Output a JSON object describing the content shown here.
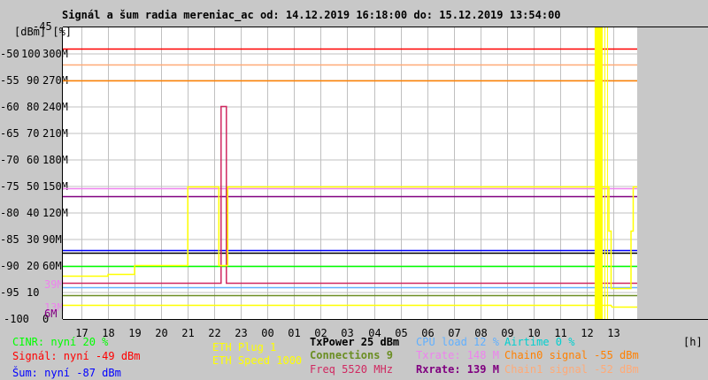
{
  "title": "Signál a šum radia mereniac_ac od: 14.12.2019 16:18:00 do: 15.12.2019 13:54:00",
  "chart_data": {
    "type": "line",
    "title": "Signál a šum radia mereniac_ac od: 14.12.2019 16:18:00 do: 15.12.2019 13:54:00",
    "x_start": "2019-12-14 16:18",
    "x_end": "2019-12-15 13:54",
    "xlabel": "[h]",
    "x_ticks": [
      "17",
      "18",
      "19",
      "20",
      "21",
      "22",
      "23",
      "00",
      "01",
      "02",
      "03",
      "04",
      "05",
      "06",
      "07",
      "08",
      "09",
      "10",
      "11",
      "12",
      "13"
    ],
    "y_axes": {
      "dBm": {
        "unit": "[dBm]",
        "range": [
          -100,
          -45
        ],
        "ticks": [
          "-45",
          "-50",
          "-55",
          "-60",
          "-65",
          "-70",
          "-75",
          "-80",
          "-85",
          "-90",
          "-95",
          "-100"
        ]
      },
      "percent": {
        "unit": "[%]",
        "range": [
          0,
          110
        ],
        "ticks": [
          "100",
          "90",
          "80",
          "70",
          "60",
          "50",
          "40",
          "30",
          "20",
          "10",
          "0"
        ]
      },
      "M": {
        "range": [
          0,
          330
        ],
        "ticks": [
          "300M",
          "270M",
          "240M",
          "210M",
          "180M",
          "150M",
          "120M",
          "90M",
          "60M"
        ]
      }
    },
    "extra_axis_labels": [
      {
        "text": "39M",
        "color": "#ee82ee",
        "value": 39
      },
      {
        "text": "13M",
        "color": "#ee82ee",
        "value": 13
      },
      {
        "text": "6M",
        "color": "#800080",
        "value": 6
      }
    ],
    "grid": true,
    "outage_band": [
      "2019-12-15 12:18",
      "2019-12-15 12:36"
    ],
    "series": [
      {
        "name": "Signál",
        "axis": "dBm",
        "color": "#ff0000",
        "points": [
          [
            "2019-12-14 16:18",
            -49
          ],
          [
            "2019-12-15 13:54",
            -49
          ]
        ]
      },
      {
        "name": "Chain1 signal",
        "axis": "dBm",
        "color": "#ffaa77",
        "points": [
          [
            "2019-12-14 16:18",
            -52
          ],
          [
            "2019-12-15 13:54",
            -52
          ]
        ]
      },
      {
        "name": "Chain0 signal",
        "axis": "dBm",
        "color": "#ff8000",
        "points": [
          [
            "2019-12-14 16:18",
            -55
          ],
          [
            "2019-12-15 13:54",
            -55
          ]
        ]
      },
      {
        "name": "Txrate",
        "axis": "M",
        "color": "#ee82ee",
        "points": [
          [
            "2019-12-14 16:18",
            148
          ],
          [
            "2019-12-15 13:54",
            148
          ]
        ]
      },
      {
        "name": "Rxrate",
        "axis": "M",
        "color": "#800080",
        "points": [
          [
            "2019-12-14 16:18",
            139
          ],
          [
            "2019-12-15 13:54",
            139
          ]
        ]
      },
      {
        "name": "Šum",
        "axis": "dBm",
        "color": "#0000ff",
        "points": [
          [
            "2019-12-14 16:18",
            -87
          ],
          [
            "2019-12-15 13:54",
            -87
          ]
        ]
      },
      {
        "name": "TxPower",
        "axis": "dBm",
        "color": "#000000",
        "points": [
          [
            "2019-12-14 16:18",
            -87.5
          ],
          [
            "2019-12-15 13:54",
            -87.5
          ]
        ]
      },
      {
        "name": "CINR",
        "axis": "percent",
        "color": "#00ff00",
        "points": [
          [
            "2019-12-14 16:18",
            20
          ],
          [
            "2019-12-15 13:54",
            20
          ]
        ]
      },
      {
        "name": "Freq",
        "axis": "M",
        "color": "#d02860",
        "points": [
          [
            "2019-12-14 16:18",
            41
          ],
          [
            "2019-12-14 22:15",
            41
          ],
          [
            "2019-12-14 22:15",
            241
          ],
          [
            "2019-12-14 22:27",
            241
          ],
          [
            "2019-12-14 22:27",
            41
          ],
          [
            "2019-12-15 13:54",
            41
          ]
        ]
      },
      {
        "name": "CPU load",
        "axis": "percent",
        "color": "#60b0ff",
        "points": [
          [
            "2019-12-14 16:18",
            12
          ],
          [
            "2019-12-15 13:54",
            12
          ]
        ]
      },
      {
        "name": "Connections",
        "axis": "percent",
        "color": "#6b8e23",
        "points": [
          [
            "2019-12-14 16:18",
            9
          ],
          [
            "2019-12-15 13:54",
            9
          ]
        ]
      },
      {
        "name": "ETH Plug",
        "axis": "M",
        "color": "#ffff00",
        "points": [
          [
            "2019-12-14 16:18",
            16
          ],
          [
            "2019-12-15 12:55",
            16
          ],
          [
            "2019-12-15 12:57",
            14
          ],
          [
            "2019-12-15 13:54",
            14
          ]
        ]
      },
      {
        "name": "ETH Speed",
        "axis": "M",
        "color": "#ffff00",
        "points": [
          [
            "2019-12-14 16:18",
            49
          ],
          [
            "2019-12-14 18:00",
            49
          ],
          [
            "2019-12-14 18:00",
            51
          ],
          [
            "2019-12-14 19:00",
            51
          ],
          [
            "2019-12-14 19:00",
            61
          ],
          [
            "2019-12-14 21:00",
            61
          ],
          [
            "2019-12-14 21:00",
            105
          ],
          [
            "2019-12-14 21:00",
            150
          ],
          [
            "2019-12-14 22:10",
            150
          ],
          [
            "2019-12-14 22:10",
            61
          ],
          [
            "2019-12-14 22:30",
            61
          ],
          [
            "2019-12-14 22:30",
            150
          ],
          [
            "2019-12-15 12:50",
            150
          ],
          [
            "2019-12-15 12:50",
            100
          ],
          [
            "2019-12-15 12:55",
            100
          ],
          [
            "2019-12-15 12:55",
            35
          ],
          [
            "2019-12-15 13:40",
            35
          ],
          [
            "2019-12-15 13:40",
            100
          ],
          [
            "2019-12-15 13:45",
            100
          ],
          [
            "2019-12-15 13:45",
            150
          ],
          [
            "2019-12-15 13:54",
            150
          ]
        ]
      }
    ]
  },
  "legend": {
    "cinr": "CINR: nyní 20 %",
    "signal": "Signál: nyní -49 dBm",
    "noise": "Šum: nyní -87 dBm",
    "eth_plug": "ETH Plug 1",
    "eth_speed": "ETH Speed 1000",
    "txpower": "TxPower 25 dBm",
    "connections": "Connections 9",
    "freq": "Freq 5520 MHz",
    "cpu": "CPU load 12 %",
    "txrate": "Txrate: 148 M",
    "rxrate": "Rxrate: 139 M",
    "airtime": "Airtime 0 %",
    "chain0": "Chain0 signal -55 dBm",
    "chain1": "Chain1 signal -52 dBm",
    "hours_unit": "[h]"
  },
  "colors": {
    "cinr": "#00ff00",
    "signal": "#ff0000",
    "noise": "#0000ff",
    "eth": "#ffff00",
    "txpower": "#000000",
    "connections": "#6b8e23",
    "freq": "#d02860",
    "cpu": "#60b0ff",
    "txrate": "#ee82ee",
    "rxrate": "#800080",
    "airtime": "#00d0d0",
    "chain0": "#ff8000",
    "chain1": "#ffaa77"
  }
}
